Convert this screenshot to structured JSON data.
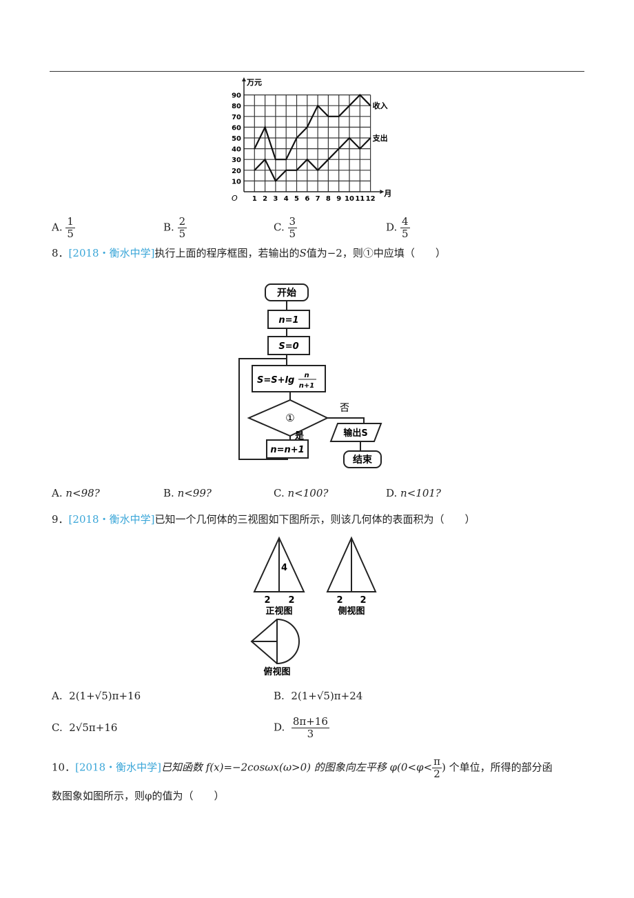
{
  "chart_data": {
    "type": "line",
    "title": "",
    "ylabel": "万元",
    "xlabel": "月",
    "origin_label": "O",
    "x": [
      1,
      2,
      3,
      4,
      5,
      6,
      7,
      8,
      9,
      10,
      11,
      12
    ],
    "yticks": [
      10,
      20,
      30,
      40,
      50,
      60,
      70,
      80,
      90
    ],
    "ylim": [
      0,
      90
    ],
    "xlim": [
      0,
      12
    ],
    "grid": true,
    "series": [
      {
        "name": "收入",
        "values": [
          40,
          60,
          30,
          30,
          50,
          60,
          80,
          70,
          70,
          80,
          90,
          80
        ]
      },
      {
        "name": "支出",
        "values": [
          20,
          30,
          10,
          20,
          20,
          30,
          20,
          30,
          40,
          50,
          40,
          50
        ]
      }
    ]
  },
  "q7": {
    "options": [
      {
        "letter": "A.",
        "num": "1",
        "den": "5"
      },
      {
        "letter": "B.",
        "num": "2",
        "den": "5"
      },
      {
        "letter": "C.",
        "num": "3",
        "den": "5"
      },
      {
        "letter": "D.",
        "num": "4",
        "den": "5"
      }
    ]
  },
  "q8": {
    "number": "8．",
    "source": "[2018・衡水中学]",
    "stem_a": "执行上面的程序框图，若输出的",
    "stem_var": "S",
    "stem_b": "值为−2，则①中应填（　　）",
    "flow": {
      "start": "开始",
      "n_init": "n=1",
      "s_init": "S=0",
      "update_a": "S=S+lg",
      "update_num": "n",
      "update_den": "n+1",
      "cond": "①",
      "no": "否",
      "yes": "是",
      "inc": "n=n+1",
      "output": "输出S",
      "end": "结束"
    },
    "options": [
      {
        "letter": "A.",
        "text": "n<98?"
      },
      {
        "letter": "B.",
        "text": "n<99?"
      },
      {
        "letter": "C.",
        "text": "n<100?"
      },
      {
        "letter": "D.",
        "text": "n<101?"
      }
    ]
  },
  "q9": {
    "number": "9．",
    "source": "[2018・衡水中学]",
    "stem": "已知一个几何体的三视图如下图所示，则该几何体的表面积为（　　）",
    "views": {
      "front": "正视图",
      "side": "侧视图",
      "top": "俯视图",
      "height": "4",
      "half_base": "2"
    },
    "options": [
      {
        "letter": "A.",
        "text": "2(1+√5)π+16"
      },
      {
        "letter": "B.",
        "text": "2(1+√5)π+24"
      },
      {
        "letter": "C.",
        "text": "2√5π+16"
      },
      {
        "letter": "D.",
        "num": "8π+16",
        "den": "3"
      }
    ]
  },
  "q10": {
    "number": "10．",
    "source": "[2018・衡水中学]",
    "stem_a": "已知函数 f(x)=−2cosωx(ω>0) 的图象向左平移 φ(0<φ<",
    "frac_num": "π",
    "frac_den": "2",
    "stem_b": ") 个单位，所得的部分函",
    "stem_c": "数图象如图所示，则φ的值为（　　）"
  }
}
